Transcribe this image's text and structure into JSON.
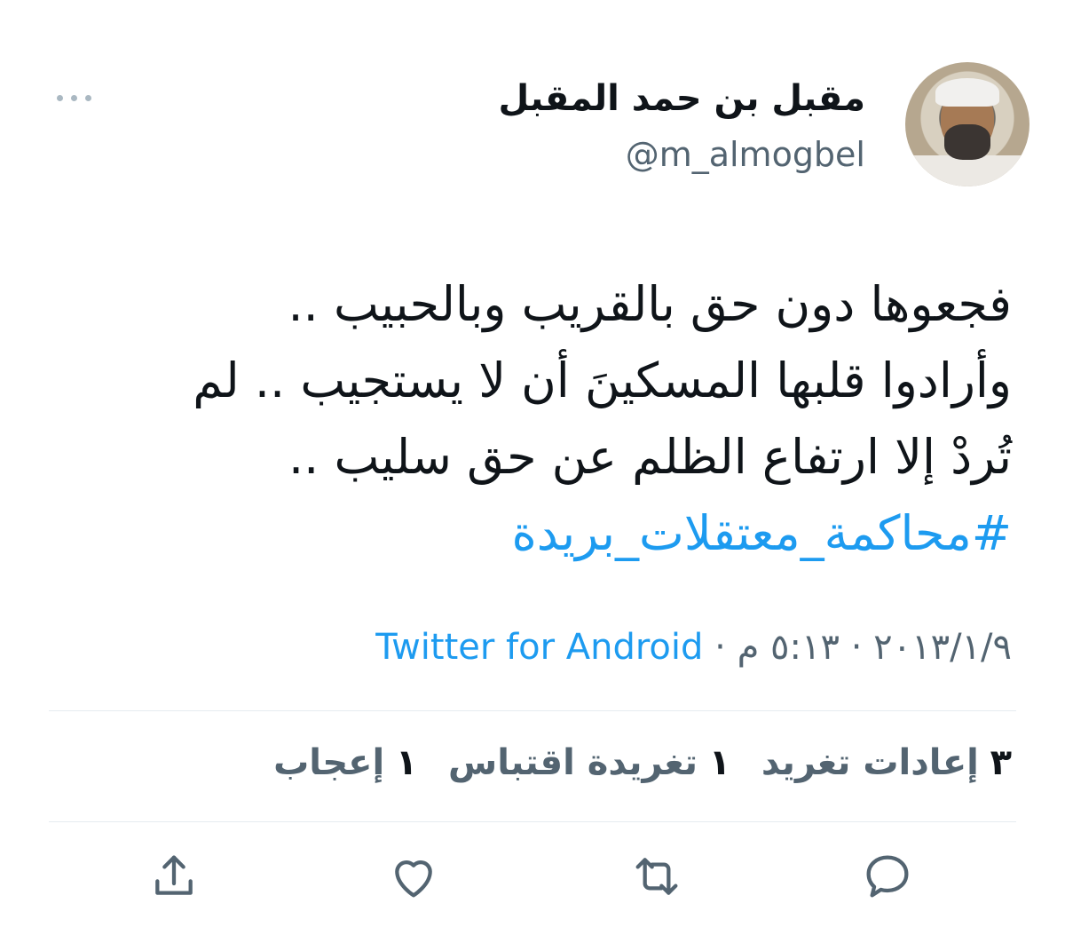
{
  "author": {
    "display_name": "مقبل بن حمد المقبل",
    "handle": "@m_almogbel"
  },
  "tweet": {
    "lines": [
      "فجعوها دون حق بالقريب وبالحبيب ..",
      "وأرادوا قلبها المسكينَ أن لا يستجيب .. لم",
      "تُردْ إلا ارتفاع الظلم عن حق سليب .."
    ],
    "hashtag": "#محاكمة_معتقلات_بريدة"
  },
  "meta": {
    "date": "٢٠١٣/١/٩",
    "separator1": " · ",
    "time": "٥:١٣ م",
    "separator2": " · ",
    "source": "Twitter for Android"
  },
  "stats": {
    "retweets_count": "٣",
    "retweets_label": "إعادات تغريد",
    "quotes_count": "١",
    "quotes_label": "تغريدة اقتباس",
    "likes_count": "١",
    "likes_label": "إعجاب"
  },
  "colors": {
    "accent": "#1d9bf0",
    "muted": "#536471",
    "text": "#0f1419",
    "divider": "#e6ecf0"
  },
  "icons": {
    "more": "more-horizontal-icon",
    "reply": "reply-icon",
    "retweet": "retweet-icon",
    "like": "heart-icon",
    "share": "share-icon"
  }
}
